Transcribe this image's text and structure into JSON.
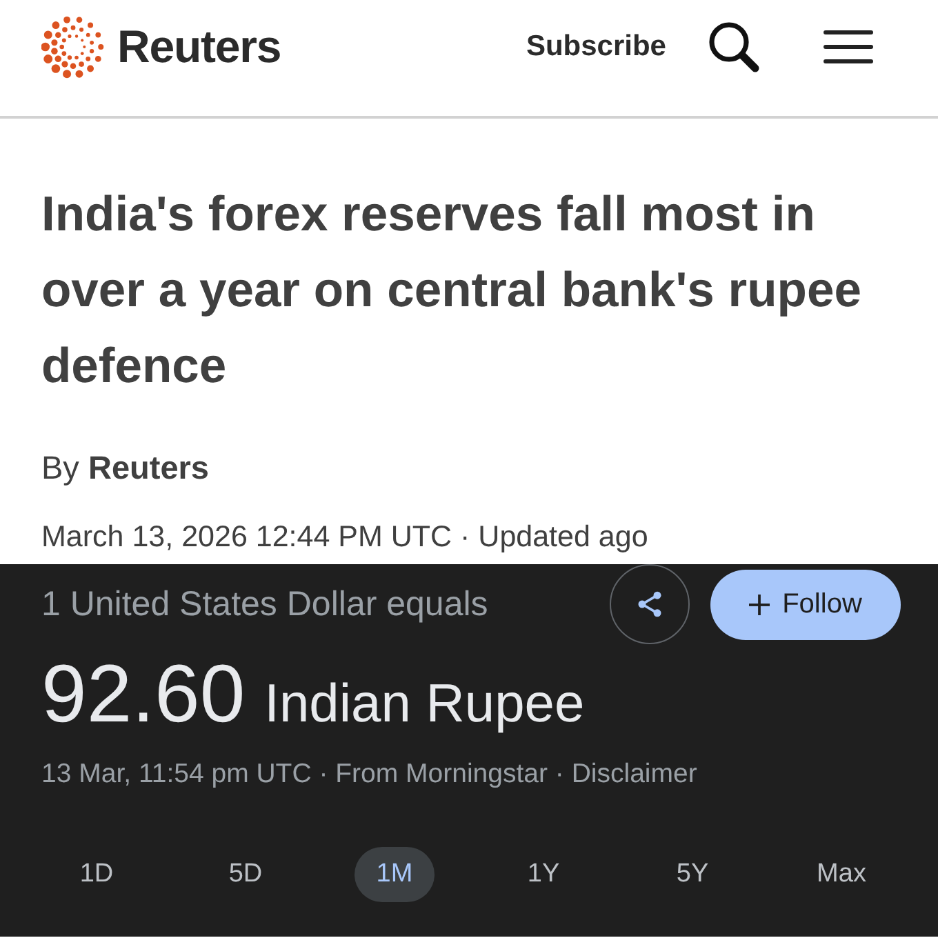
{
  "header": {
    "brand": "Reuters",
    "subscribe": "Subscribe"
  },
  "article": {
    "headline": "India's forex reserves fall most in over a year on central bank's rupee defence",
    "byline": "By **Reuters**",
    "dateline": "March 13, 2026 12:44 PM UTC · Updated ago"
  },
  "converter": {
    "label": "1 United States Dollar equals",
    "value": "92.60",
    "currency": "Indian Rupee",
    "source": "13 Mar, 11:54 pm UTC · From Morningstar · Disclaimer",
    "follow_button": "Follow",
    "ranges": [
      {
        "label": "1D",
        "selected": false
      },
      {
        "label": "5D",
        "selected": false
      },
      {
        "label": "1M",
        "selected": true
      },
      {
        "label": "1Y",
        "selected": false
      },
      {
        "label": "5Y",
        "selected": false
      },
      {
        "label": "Max",
        "selected": false
      }
    ]
  }
}
